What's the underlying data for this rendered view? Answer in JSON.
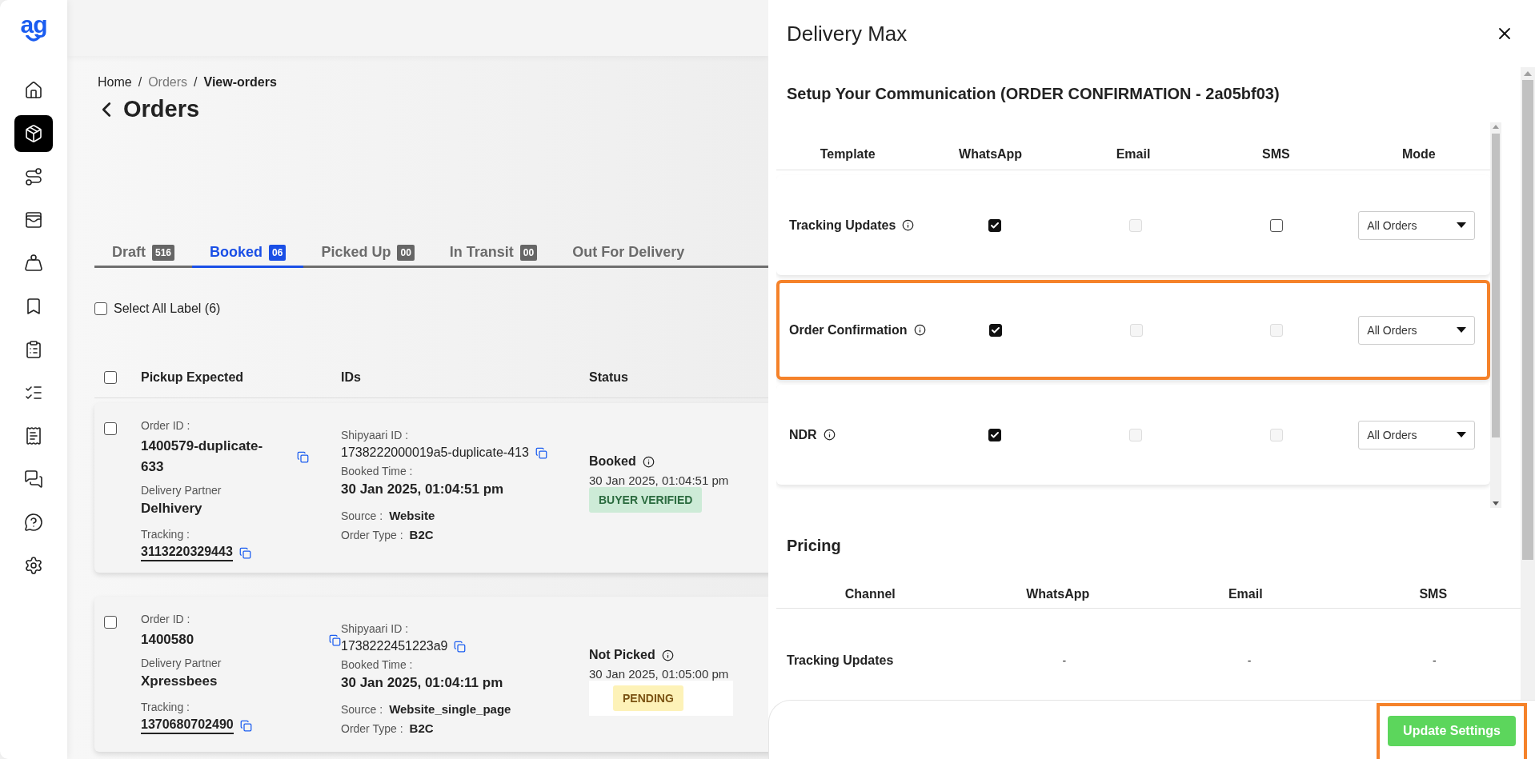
{
  "sidebar": {
    "logo": "ag",
    "items": [
      {
        "selected": false
      },
      {
        "selected": true
      },
      {
        "selected": false
      },
      {
        "selected": false
      },
      {
        "selected": false
      },
      {
        "selected": false
      },
      {
        "selected": false
      },
      {
        "selected": false
      },
      {
        "selected": false
      },
      {
        "selected": false
      },
      {
        "selected": false
      },
      {
        "selected": false
      }
    ]
  },
  "breadcrumb": {
    "separator": "/",
    "items": [
      {
        "label": "Home",
        "kind": "link"
      },
      {
        "label": "Orders",
        "kind": "muted"
      },
      {
        "label": "View-orders",
        "kind": "current"
      }
    ]
  },
  "page_title": "Orders",
  "tabs": [
    {
      "label": "Draft",
      "count": "516",
      "selected": false
    },
    {
      "label": "Booked",
      "count": "06",
      "selected": true
    },
    {
      "label": "Picked Up",
      "count": "00",
      "selected": false
    },
    {
      "label": "In Transit",
      "count": "00",
      "selected": false
    },
    {
      "label": "Out For Delivery",
      "selected": false
    }
  ],
  "select_all": {
    "label": "Select All Label (6)",
    "checked": false
  },
  "table": {
    "checked": false,
    "columns": [
      "Pickup Expected",
      "IDs",
      "Status"
    ],
    "rows": [
      {
        "checked": false,
        "order_id_label": "Order ID :",
        "order_id": "1400579-duplicate-633",
        "partner_label": "Delivery Partner",
        "partner": "Delhivery",
        "tracking_label": "Tracking :",
        "tracking": "3113220329443",
        "shipyaari_label": "Shipyaari ID :",
        "shipyaari_id": "1738222000019a5-duplicate-413",
        "booked_label": "Booked Time :",
        "booked_time": "30 Jan 2025, 01:04:51 pm",
        "source_label": "Source :",
        "source": "Website",
        "type_label": "Order Type :",
        "order_type": "B2C",
        "status": "Booked",
        "status_time": "30 Jan 2025, 01:04:51 pm",
        "badge": {
          "label": "BUYER VERIFIED",
          "kind": "verified"
        }
      },
      {
        "checked": false,
        "order_id_label": "Order ID :",
        "order_id": "1400580",
        "partner_label": "Delivery Partner",
        "partner": "Xpressbees",
        "tracking_label": "Tracking :",
        "tracking": "1370680702490",
        "shipyaari_label": "Shipyaari ID :",
        "shipyaari_id": "1738222451223a9",
        "booked_label": "Booked Time :",
        "booked_time": "30 Jan 2025, 01:04:11 pm",
        "source_label": "Source :",
        "source": "Website_single_page",
        "type_label": "Order Type :",
        "order_type": "B2C",
        "status": "Not Picked",
        "status_time": "30 Jan 2025, 01:05:00 pm",
        "badge": {
          "label": "PENDING",
          "kind": "pending"
        }
      }
    ]
  },
  "panel": {
    "title": "Delivery Max",
    "section_title": "Setup Your Communication (ORDER CONFIRMATION - 2a05bf03)",
    "columns": [
      "Template",
      "WhatsApp",
      "Email",
      "SMS",
      "Mode"
    ],
    "templates": [
      {
        "name": "Tracking Updates",
        "highlighted": false,
        "channels": [
          {
            "checked": true,
            "disabled": false
          },
          {
            "checked": false,
            "disabled": true
          },
          {
            "checked": false,
            "disabled": false
          }
        ],
        "mode": "All Orders"
      },
      {
        "name": "Order Confirmation",
        "highlighted": true,
        "channels": [
          {
            "checked": true,
            "disabled": false
          },
          {
            "checked": false,
            "disabled": true
          },
          {
            "checked": false,
            "disabled": true
          }
        ],
        "mode": "All Orders"
      },
      {
        "name": "NDR",
        "highlighted": false,
        "channels": [
          {
            "checked": true,
            "disabled": false
          },
          {
            "checked": false,
            "disabled": true
          },
          {
            "checked": false,
            "disabled": true
          }
        ],
        "mode": "All Orders"
      }
    ],
    "pricing": {
      "title": "Pricing",
      "columns": [
        "Channel",
        "WhatsApp",
        "Email",
        "SMS"
      ],
      "rows": [
        {
          "channel": "Tracking Updates",
          "values": [
            "-",
            "-",
            "-"
          ]
        }
      ]
    },
    "update_button": {
      "label": "Update Settings",
      "highlighted": true
    }
  }
}
